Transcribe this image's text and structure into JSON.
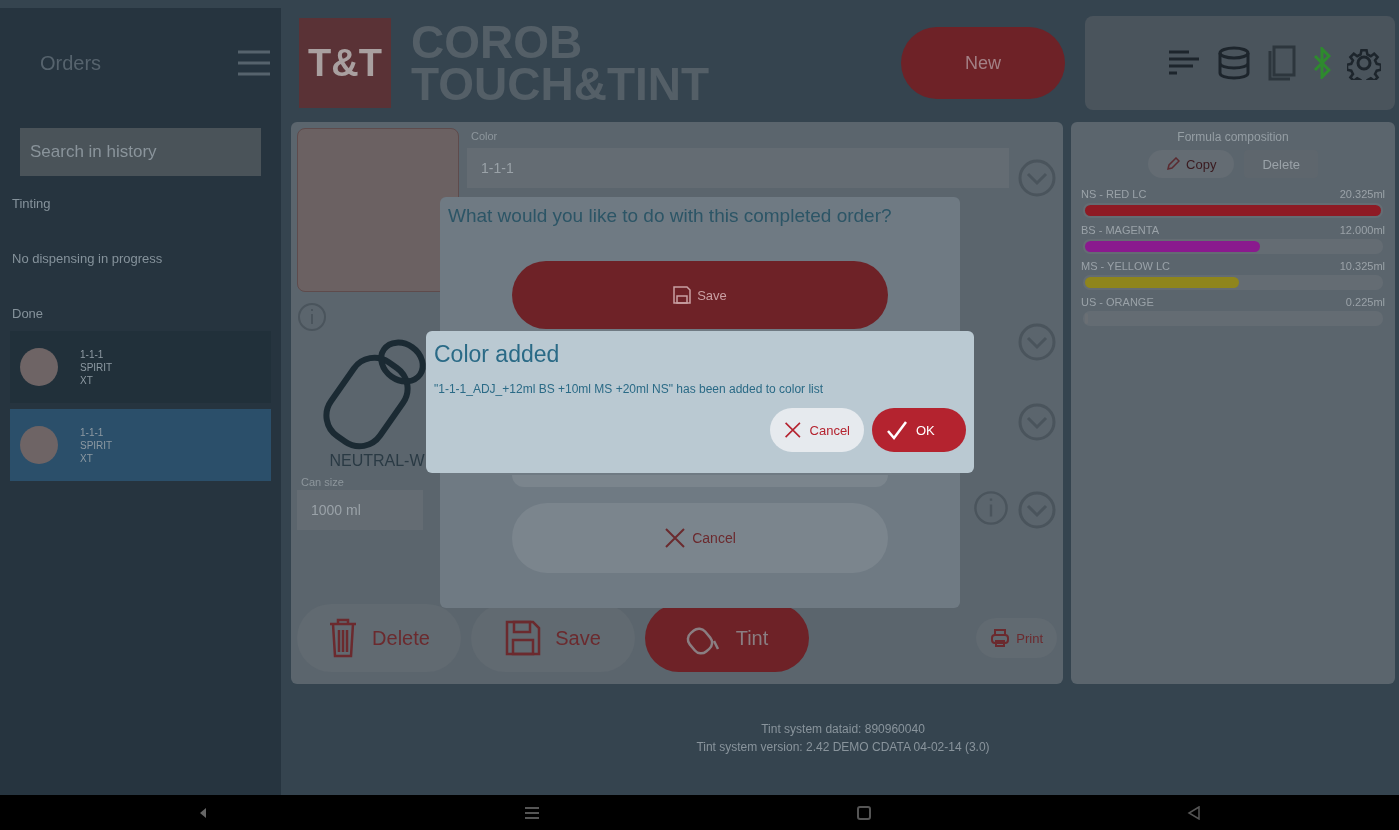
{
  "sidebar": {
    "title": "Orders",
    "search": {
      "placeholder": "Search in history"
    },
    "sections": [
      {
        "label": "Tinting"
      },
      {
        "label": "No dispensing in progress"
      },
      {
        "label": "Done"
      }
    ],
    "orders": [
      {
        "code": "1-1-1",
        "product": "SPIRIT",
        "base": "XT",
        "selected": false
      },
      {
        "code": "1-1-1",
        "product": "SPIRIT",
        "base": "XT",
        "selected": true
      }
    ]
  },
  "header": {
    "logo": "T&T",
    "brand_line1": "COROB",
    "brand_line2": "TOUCH&TINT",
    "new_button": "New"
  },
  "order": {
    "color_label": "Color",
    "color_value": "1-1-1",
    "product_label": "NEUTRAL-W",
    "can_label": "Can size",
    "can_value": "1000 ml",
    "buttons": [
      {
        "kind": "delete",
        "label": "Delete"
      },
      {
        "kind": "save",
        "label": "Save"
      },
      {
        "kind": "tint",
        "label": "Tint"
      }
    ],
    "print": "Print"
  },
  "formula": {
    "title": "Formula composition",
    "copy": "Copy",
    "delete": "Delete",
    "colorants": [
      {
        "name": "NS - RED LC",
        "amount": "20.325ml",
        "color": "#8e1a24",
        "level": 1.0
      },
      {
        "name": "BS - MAGENTA",
        "amount": "12.000ml",
        "color": "#8a1a8e",
        "level": 0.59
      },
      {
        "name": "MS - YELLOW LC",
        "amount": "10.325ml",
        "color": "#8f851c",
        "level": 0.52
      },
      {
        "name": "US - ORANGE",
        "amount": "0.225ml",
        "color": "#6a6f74",
        "level": 0.01
      }
    ]
  },
  "footer": [
    "Tint system dataid: 890960040",
    "Tint system version: 2.42  DEMO CDATA 04-02-14 (3.0)"
  ],
  "order_dialog": {
    "question": "What would you like to do with this completed order?",
    "save": "Save",
    "cancel": "Cancel"
  },
  "color_dialog": {
    "title": "Color added",
    "message": "\"1-1-1_ADJ_+12ml BS +10ml MS +20ml NS\" has been added to color list",
    "cancel": "Cancel",
    "ok": "OK"
  }
}
